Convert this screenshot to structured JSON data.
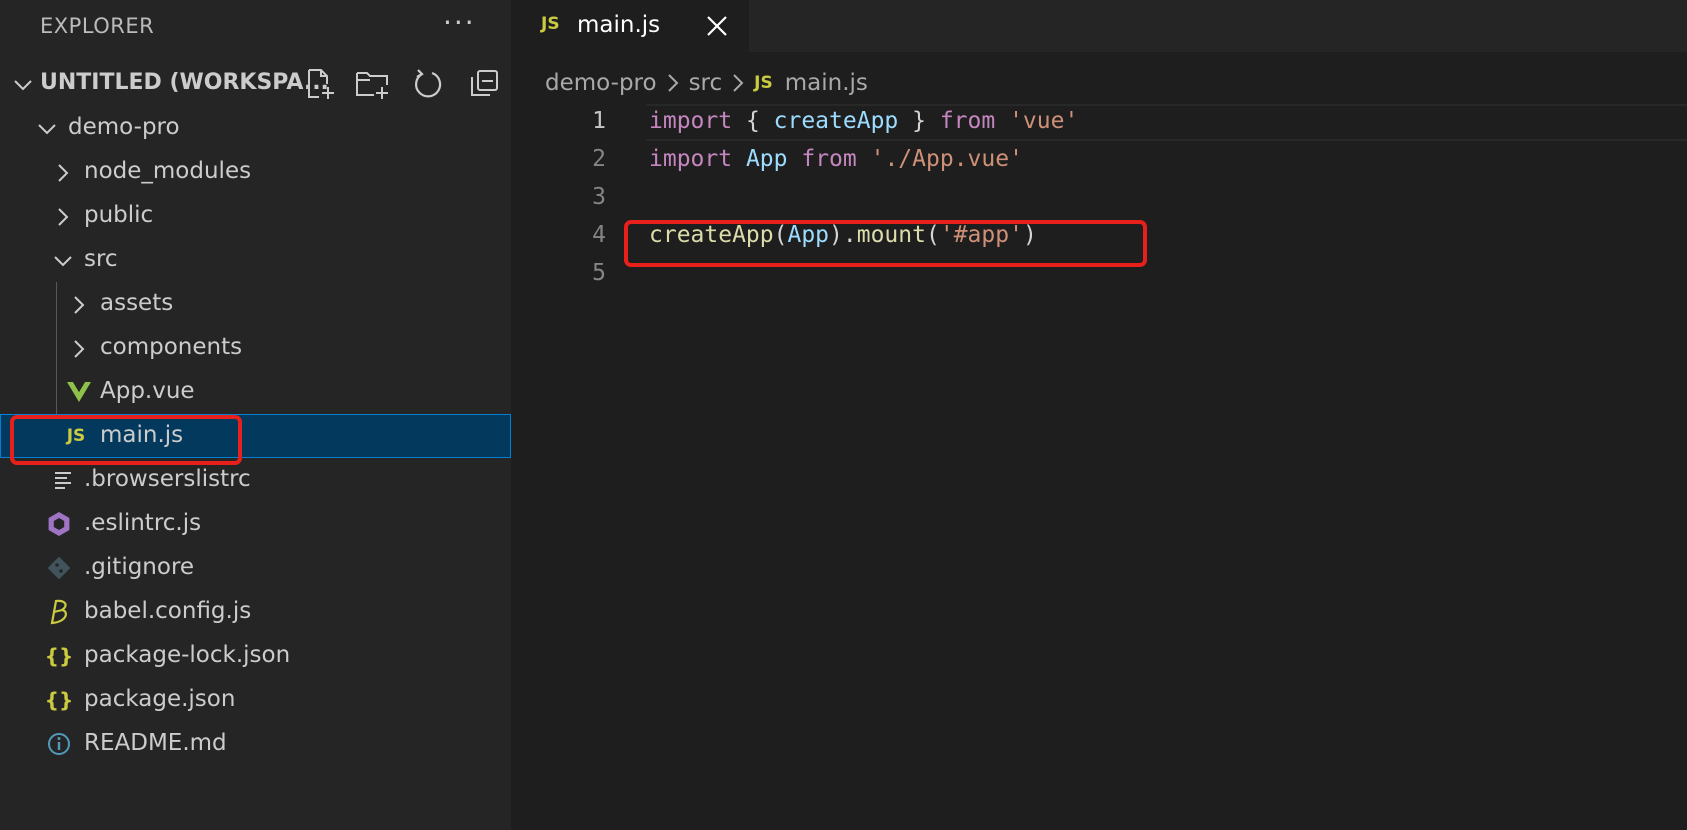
{
  "sidebar": {
    "title": "EXPLORER",
    "more_label": "···",
    "workspace": {
      "title": "UNTITLED (WORKSPA...",
      "actions": [
        "new-file-icon",
        "new-folder-icon",
        "refresh-icon",
        "collapse-all-icon"
      ]
    },
    "tree": [
      {
        "label": "demo-pro",
        "type": "folder",
        "expanded": true,
        "depth": 0
      },
      {
        "label": "node_modules",
        "type": "folder",
        "expanded": false,
        "depth": 1
      },
      {
        "label": "public",
        "type": "folder",
        "expanded": false,
        "depth": 1
      },
      {
        "label": "src",
        "type": "folder",
        "expanded": true,
        "depth": 1
      },
      {
        "label": "assets",
        "type": "folder",
        "expanded": false,
        "depth": 2
      },
      {
        "label": "components",
        "type": "folder",
        "expanded": false,
        "depth": 2
      },
      {
        "label": "App.vue",
        "type": "file",
        "icon": "vue-icon",
        "depth": 2
      },
      {
        "label": "main.js",
        "type": "file",
        "icon": "js-icon",
        "icon_text": "JS",
        "depth": 2,
        "selected": true
      },
      {
        "label": ".browserslistrc",
        "type": "file",
        "icon": "lines-icon",
        "depth": 1
      },
      {
        "label": ".eslintrc.js",
        "type": "file",
        "icon": "eslint-icon",
        "depth": 1
      },
      {
        "label": ".gitignore",
        "type": "file",
        "icon": "git-icon",
        "depth": 1
      },
      {
        "label": "babel.config.js",
        "type": "file",
        "icon": "babel-icon",
        "depth": 1
      },
      {
        "label": "package-lock.json",
        "type": "file",
        "icon": "json-icon",
        "icon_text": "{}",
        "depth": 1
      },
      {
        "label": "package.json",
        "type": "file",
        "icon": "json-icon",
        "icon_text": "{}",
        "depth": 1
      },
      {
        "label": "README.md",
        "type": "file",
        "icon": "info-icon",
        "depth": 1
      }
    ]
  },
  "editor": {
    "tab": {
      "label": "main.js",
      "icon_text": "JS"
    },
    "breadcrumb": {
      "folder": "demo-pro",
      "subfolder": "src",
      "icon_text": "JS",
      "file": "main.js"
    },
    "lines": [
      {
        "number": "1",
        "tokens": [
          {
            "t": "import",
            "c": "keyword"
          },
          {
            "t": " { ",
            "c": "punct"
          },
          {
            "t": "createApp",
            "c": "var"
          },
          {
            "t": " } ",
            "c": "punct"
          },
          {
            "t": "from",
            "c": "keyword"
          },
          {
            "t": " ",
            "c": "punct"
          },
          {
            "t": "'vue'",
            "c": "string"
          }
        ]
      },
      {
        "number": "2",
        "tokens": [
          {
            "t": "import",
            "c": "keyword"
          },
          {
            "t": " ",
            "c": "punct"
          },
          {
            "t": "App",
            "c": "var"
          },
          {
            "t": " ",
            "c": "punct"
          },
          {
            "t": "from",
            "c": "keyword"
          },
          {
            "t": " ",
            "c": "punct"
          },
          {
            "t": "'./App.vue'",
            "c": "string"
          }
        ]
      },
      {
        "number": "3",
        "tokens": []
      },
      {
        "number": "4",
        "tokens": [
          {
            "t": "createApp",
            "c": "func"
          },
          {
            "t": "(",
            "c": "punct"
          },
          {
            "t": "App",
            "c": "var"
          },
          {
            "t": ").",
            "c": "punct"
          },
          {
            "t": "mount",
            "c": "func"
          },
          {
            "t": "(",
            "c": "punct"
          },
          {
            "t": "'#app'",
            "c": "string"
          },
          {
            "t": ")",
            "c": "punct"
          }
        ]
      },
      {
        "number": "5",
        "tokens": []
      }
    ]
  },
  "colors": {
    "annotation": "#e8201c",
    "selection": "#04395e",
    "selection_border": "#007fd4",
    "js": "#cbcb41",
    "vue": "#8dc149",
    "eslint": "#a074c4",
    "json": "#cbcb41",
    "info": "#519aba"
  }
}
